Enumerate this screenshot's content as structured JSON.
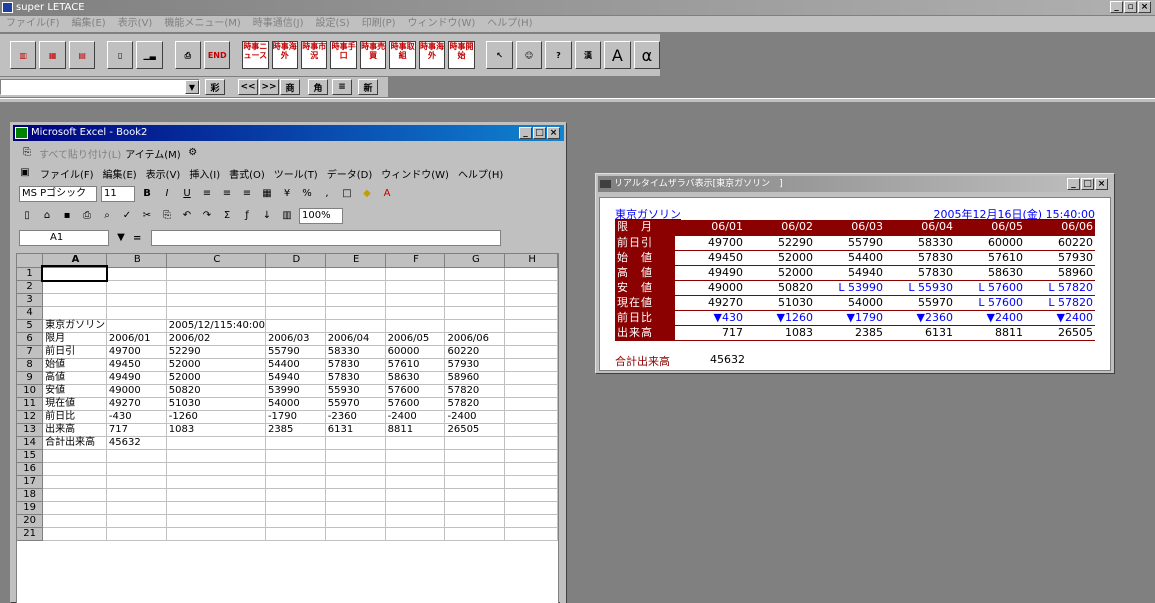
{
  "app": {
    "title": "super LETACE",
    "menu": [
      "ファイル(F)",
      "編集(E)",
      "表示(V)",
      "機能メニュー(M)",
      "時事通信(J)",
      "設定(S)",
      "印刷(P)",
      "ウィンドウ(W)",
      "ヘルプ(H)"
    ],
    "toolbar_jiji": [
      "時事ニュース",
      "時事海外",
      "時事市況",
      "時事手口",
      "時事売買",
      "時事取組",
      "時事海外",
      "時事開始"
    ],
    "end_label": "END",
    "alpha_label": "α",
    "a_label": "A",
    "toolbar2": [
      "<<",
      ">>",
      "商",
      "新"
    ]
  },
  "excel": {
    "title": "Microsoft Excel - Book2",
    "paste_menu": "すべて貼り付け(L)",
    "items_menu": "アイテム(M)",
    "menu": [
      "ファイル(F)",
      "編集(E)",
      "表示(V)",
      "挿入(I)",
      "書式(O)",
      "ツール(T)",
      "データ(D)",
      "ウィンドウ(W)",
      "ヘルプ(H)"
    ],
    "font": "MS Pゴシック",
    "font_size": "11",
    "zoom": "100%",
    "name_box": "A1",
    "formula_eq": "=",
    "columns": [
      "A",
      "B",
      "C",
      "D",
      "E",
      "F",
      "G",
      "H"
    ],
    "rows": [
      [
        "",
        "",
        "",
        "",
        "",
        "",
        "",
        ""
      ],
      [
        "",
        "",
        "",
        "",
        "",
        "",
        "",
        ""
      ],
      [
        "",
        "",
        "",
        "",
        "",
        "",
        "",
        ""
      ],
      [
        "",
        "",
        "",
        "",
        "",
        "",
        "",
        ""
      ],
      [
        "東京ガソリン",
        "",
        "2005/12/115:40:00",
        "",
        "",
        "",
        "",
        ""
      ],
      [
        "限月",
        "2006/01",
        "2006/02",
        "2006/03",
        "2006/04",
        "2006/05",
        "2006/06",
        ""
      ],
      [
        "前日引",
        "49700",
        "52290",
        "55790",
        "58330",
        "60000",
        "60220",
        ""
      ],
      [
        "始値",
        "49450",
        "52000",
        "54400",
        "57830",
        "57610",
        "57930",
        ""
      ],
      [
        "高値",
        "49490",
        "52000",
        "54940",
        "57830",
        "58630",
        "58960",
        ""
      ],
      [
        "安値",
        "49000",
        "50820",
        "53990",
        "55930",
        "57600",
        "57820",
        ""
      ],
      [
        "現在値",
        "49270",
        "51030",
        "54000",
        "55970",
        "57600",
        "57820",
        ""
      ],
      [
        "前日比",
        "-430",
        "-1260",
        "-1790",
        "-2360",
        "-2400",
        "-2400",
        ""
      ],
      [
        "出来高",
        "717",
        "1083",
        "2385",
        "6131",
        "8811",
        "26505",
        ""
      ],
      [
        "合計出来高",
        "45632",
        "",
        "",
        "",
        "",
        "",
        ""
      ],
      [
        "",
        "",
        "",
        "",
        "",
        "",
        "",
        ""
      ],
      [
        "",
        "",
        "",
        "",
        "",
        "",
        "",
        ""
      ],
      [
        "",
        "",
        "",
        "",
        "",
        "",
        "",
        ""
      ],
      [
        "",
        "",
        "",
        "",
        "",
        "",
        "",
        ""
      ],
      [
        "",
        "",
        "",
        "",
        "",
        "",
        "",
        ""
      ],
      [
        "",
        "",
        "",
        "",
        "",
        "",
        "",
        ""
      ],
      [
        "",
        "",
        "",
        "",
        "",
        "",
        "",
        ""
      ]
    ]
  },
  "realtime": {
    "title": "リアルタイムザラバ表示[東京ガソリン　]",
    "name": "東京ガソリン",
    "datetime": "2005年12月16日(金) 15:40:00",
    "header_label": "限　月",
    "months": [
      "06/01",
      "06/02",
      "06/03",
      "06/04",
      "06/05",
      "06/06"
    ],
    "rows": [
      {
        "label": "前日引",
        "values": [
          "49700",
          "52290",
          "55790",
          "58330",
          "60000",
          "60220"
        ]
      },
      {
        "label": "始　値",
        "values": [
          "49450",
          "52000",
          "54400",
          "57830",
          "57610",
          "57930"
        ]
      },
      {
        "label": "高　値",
        "values": [
          "49490",
          "52000",
          "54940",
          "57830",
          "58630",
          "58960"
        ]
      },
      {
        "label": "安　値",
        "values": [
          "49000",
          "50820",
          "L 53990",
          "L 55930",
          "L 57600",
          "L 57820"
        ]
      },
      {
        "label": "現在値",
        "values": [
          "49270",
          "51030",
          "54000",
          "55970",
          "L 57600",
          "L 57820"
        ]
      },
      {
        "label": "前日比",
        "values": [
          "▼430",
          "▼1260",
          "▼1790",
          "▼2360",
          "▼2400",
          "▼2400"
        ]
      },
      {
        "label": "出来高",
        "values": [
          "717",
          "1083",
          "2385",
          "6131",
          "8811",
          "26505"
        ]
      }
    ],
    "total_label": "合計出来高",
    "total_value": "45632",
    "colors": {
      "header_bg": "#8b0000",
      "accent": "#0000ff"
    }
  }
}
